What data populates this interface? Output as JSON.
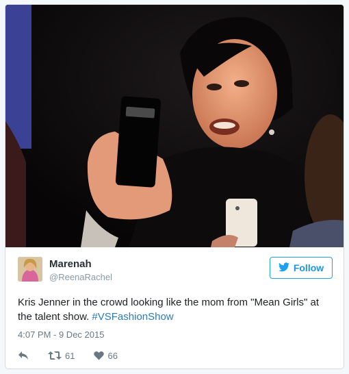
{
  "tweet": {
    "author_name": "Marenah",
    "author_handle": "@ReenaRachel",
    "follow_label": "Follow",
    "text_main": "Kris Jenner in the crowd looking like the mom from \"Mean Girls\" at the talent show. ",
    "hashtag": "#VSFashionShow",
    "timestamp": "4:07 PM - 9 Dec 2015",
    "retweets": "61",
    "likes": "66"
  },
  "icons": {
    "reply": "reply-icon",
    "retweet": "retweet-icon",
    "like": "heart-icon",
    "follow": "twitter-bird-icon"
  },
  "colors": {
    "accent": "#1da1f2",
    "link": "#2b7bb9",
    "text": "#1c2022",
    "muted": "#697882"
  }
}
